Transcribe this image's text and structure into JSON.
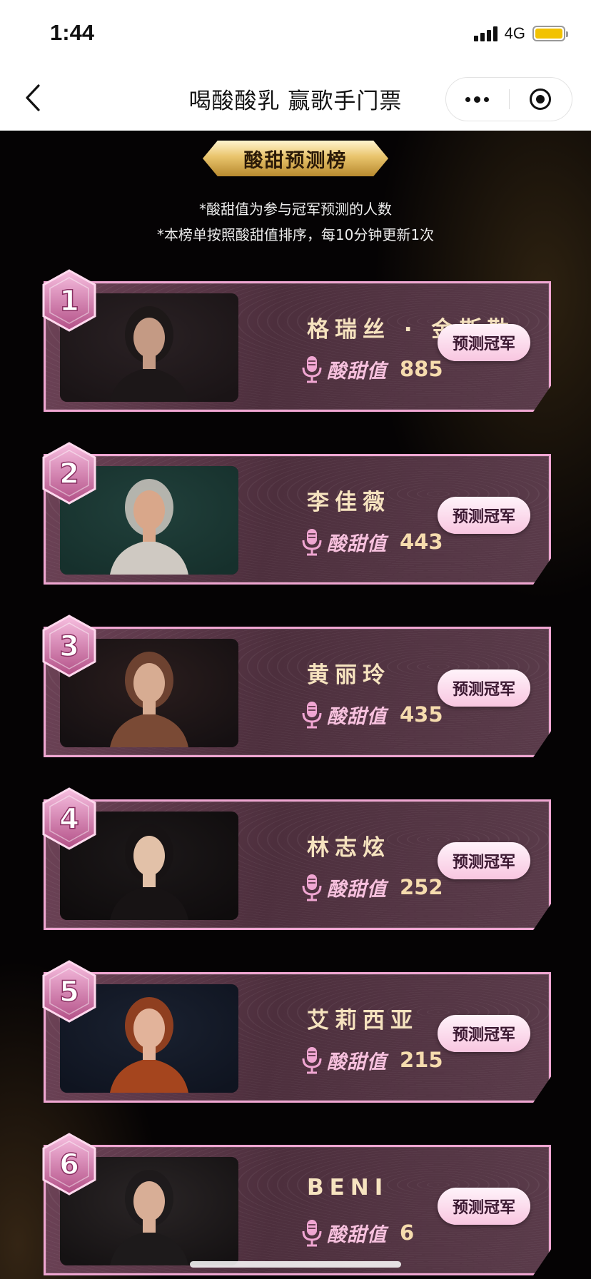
{
  "status": {
    "time": "1:44",
    "network": "4G"
  },
  "nav": {
    "title": "喝酸酸乳 赢歌手门票"
  },
  "banner": {
    "title": "酸甜预测榜"
  },
  "notes": [
    "*酸甜值为参与冠军预测的人数",
    "*本榜单按照酸甜值排序，每10分钟更新1次"
  ],
  "score_label": "酸甜值",
  "predict_label": "预测冠军",
  "entries": [
    {
      "rank": "1",
      "name": "格瑞丝 · 金斯勒",
      "score": "885"
    },
    {
      "rank": "2",
      "name": "李佳薇",
      "score": "443"
    },
    {
      "rank": "3",
      "name": "黄丽玲",
      "score": "435"
    },
    {
      "rank": "4",
      "name": "林志炫",
      "score": "252"
    },
    {
      "rank": "5",
      "name": "艾莉西亚",
      "score": "215"
    },
    {
      "rank": "6",
      "name": "BENI",
      "score": "6"
    }
  ],
  "colors": {
    "card_border": "#f0a6d2",
    "card_bg": "#4d2f3d",
    "name_text": "#f6e3bf",
    "score_label": "#f7c1de",
    "score_value": "#f6dcae",
    "banner_gold": "#e9c46c",
    "battery": "#f2c200"
  }
}
